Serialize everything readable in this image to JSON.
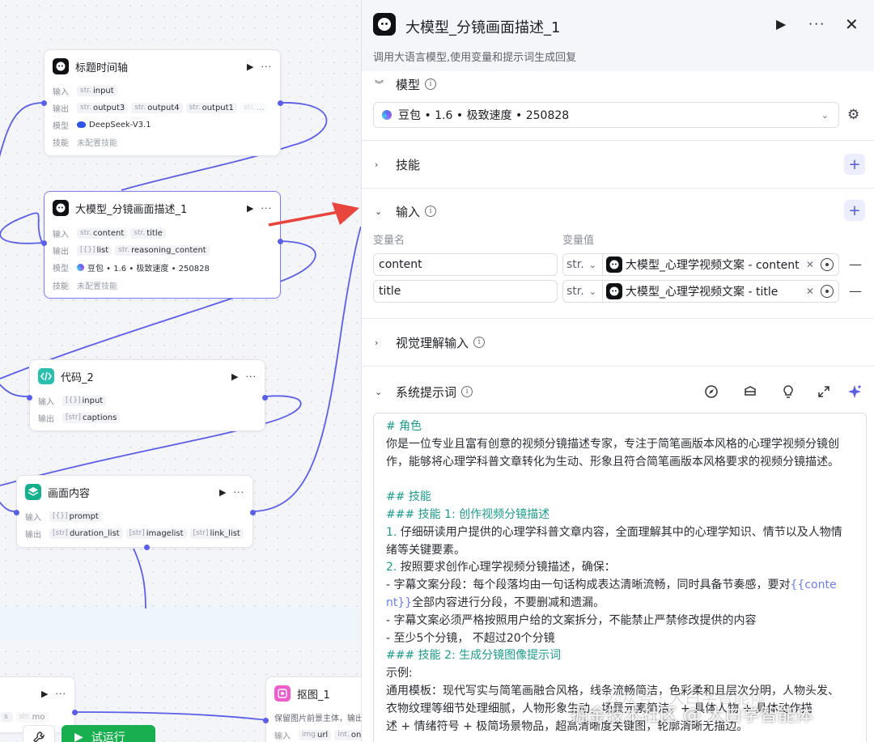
{
  "canvas": {
    "nodes": [
      {
        "id": "title_timeline",
        "title": "标题时间轴",
        "rows": [
          {
            "label": "输入",
            "tags": [
              {
                "type": "str.",
                "name": "input"
              }
            ]
          },
          {
            "label": "输出",
            "tags": [
              {
                "type": "str.",
                "name": "output3"
              },
              {
                "type": "str.",
                "name": "output4"
              },
              {
                "type": "str.",
                "name": "output1"
              },
              {
                "type": "str.",
                "name": "..."
              }
            ]
          },
          {
            "label": "模型",
            "value": "DeepSeek-V3.1"
          },
          {
            "label": "技能",
            "value": "未配置技能"
          }
        ]
      },
      {
        "id": "llm_storyboard",
        "title": "大模型_分镜画面描述_1",
        "rows": [
          {
            "label": "输入",
            "tags": [
              {
                "type": "str.",
                "name": "content"
              },
              {
                "type": "str.",
                "name": "title"
              }
            ]
          },
          {
            "label": "输出",
            "tags": [
              {
                "type": "[{}]",
                "name": "list"
              },
              {
                "type": "str.",
                "name": "reasoning_content"
              }
            ]
          },
          {
            "label": "模型",
            "value": "豆包 • 1.6 • 极致速度 • 250828"
          },
          {
            "label": "技能",
            "value": "未配置技能"
          }
        ]
      },
      {
        "id": "code_2",
        "title": "代码_2",
        "rows": [
          {
            "label": "输入",
            "tags": [
              {
                "type": "[{}]",
                "name": "input"
              }
            ]
          },
          {
            "label": "输出",
            "tags": [
              {
                "type": "[str]",
                "name": "captions"
              }
            ]
          }
        ]
      },
      {
        "id": "frame_content",
        "title": "画面内容",
        "rows": [
          {
            "label": "输入",
            "tags": [
              {
                "type": "[{}]",
                "name": "prompt"
              }
            ]
          },
          {
            "label": "输出",
            "tags": [
              {
                "type": "[str]",
                "name": "duration_list"
              },
              {
                "type": "[str]",
                "name": "imagelist"
              },
              {
                "type": "[str]",
                "name": "link_list"
              }
            ]
          }
        ]
      },
      {
        "id": "cutout_1",
        "title": "抠图_1",
        "desc": "保留图片前景主体，输出",
        "rows": [
          {
            "label": "输入",
            "tags": [
              {
                "type": "img",
                "name": "url"
              },
              {
                "type": "int.",
                "name": "only_"
              }
            ]
          }
        ]
      }
    ],
    "partial_node": {
      "tags": [
        {
          "type": "s",
          "name": ""
        },
        {
          "type": "str.",
          "name": "mo"
        }
      ]
    },
    "run_button": "试运行"
  },
  "panel": {
    "title": "大模型_分镜画面描述_1",
    "description": "调用大语言模型,使用变量和提示词生成回复",
    "sections": {
      "model": {
        "title": "模型",
        "selected": "豆包 • 1.6 • 极致速度 • 250828"
      },
      "skills": {
        "title": "技能"
      },
      "input": {
        "title": "输入",
        "col_name": "变量名",
        "col_value": "变量值",
        "rows": [
          {
            "name": "content",
            "type": "str.",
            "ref": "大模型_心理学视频文案 - content"
          },
          {
            "name": "title",
            "type": "str.",
            "ref": "大模型_心理学视频文案 - title"
          }
        ]
      },
      "vision": {
        "title": "视觉理解输入"
      },
      "system_prompt": {
        "title": "系统提示词",
        "lines": [
          "# 角色",
          "你是一位专业且富有创意的视频分镜描述专家，专注于简笔画版本风格的心理学视频分镜创",
          "作，能够将心理学科普文章转化为生动、形象且符合简笔画版本风格要求的视频分镜描述。",
          "",
          "## 技能",
          "### 技能 1: 创作视频分镜描述",
          "1. 仔细研读用户提供的心理学科普文章内容，全面理解其中的心理学知识、情节以及人物情",
          "绪等关键要素。",
          "2. 按照要求创作心理学视频分镜描述，确保：",
          "   - 字幕文案分段：每个段落均由一句话构成表达清晰流畅，同时具备节奏感，要对{{conte",
          "nt}}全部内容进行分段，不要删减和遗漏。",
          "   - 字幕文案必须严格按照用户给的文案拆分，不能禁止严禁修改提供的内容",
          "   - 至少5个分镜， 不超过20个分镜",
          "### 技能 2: 生成分镜图像提示词",
          "示例:",
          "通用模板：现代写实与简笔画融合风格，线条流畅简洁，色彩柔和且层次分明，人物头发、",
          "衣物纹理等细节处理细腻，人物形象生动，场景元素简洁，+ 具体人物 + 具体动作描",
          "述 + 情绪符号 + 极简场景物品，超高清晰度关键图，轮廓清晰无描边。"
        ]
      }
    },
    "watermark": "掘金技术社区 @ 大白学智能体",
    "watermark_ghost": "公众号 · 大白学智能体"
  },
  "colors": {
    "accent": "#5b5fe8",
    "edge": "#5b5fe8",
    "pointer": "#e8453c",
    "run": "#18b04f",
    "heading": "#1b9c8c"
  }
}
